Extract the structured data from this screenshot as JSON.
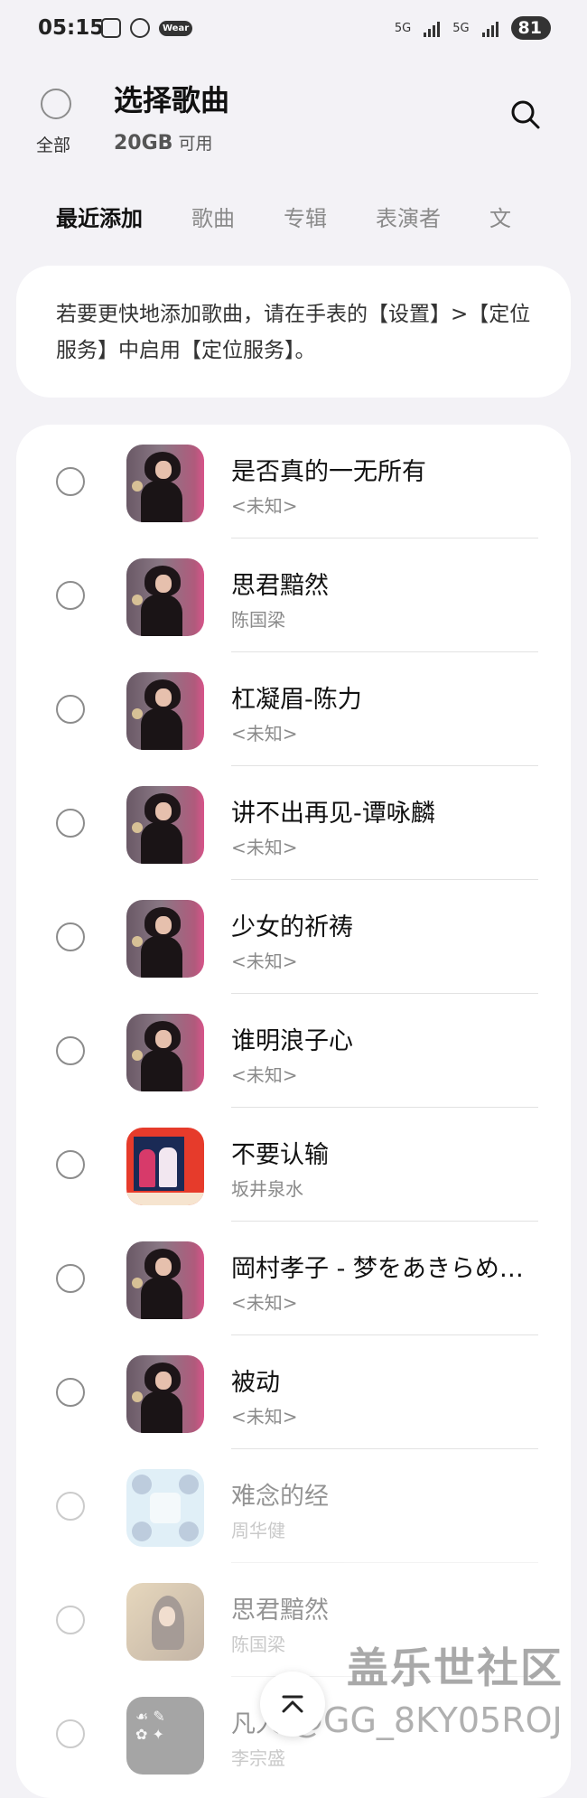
{
  "status_bar": {
    "time": "05:15",
    "icons": [
      "screenshot-icon",
      "location-icon",
      "wear-icon"
    ],
    "wear_label": "Wear",
    "net1": "5G",
    "net2": "5G",
    "battery": "81"
  },
  "header": {
    "select_all_label": "全部",
    "title": "选择歌曲",
    "storage_amount": "20GB",
    "storage_unit": "可用"
  },
  "tabs": [
    {
      "label": "最近添加",
      "active": true
    },
    {
      "label": "歌曲"
    },
    {
      "label": "专辑"
    },
    {
      "label": "表演者"
    },
    {
      "label": "文"
    }
  ],
  "banner": {
    "text": "若要更快地添加歌曲，请在手表的【设置】>【定位服务】中启用【定位服务】。"
  },
  "songs": [
    {
      "title": "是否真的一无所有",
      "artist": "<未知>",
      "art": "woman"
    },
    {
      "title": "思君黯然",
      "artist": "陈国梁",
      "art": "woman"
    },
    {
      "title": "杠凝眉-陈力",
      "artist": "<未知>",
      "art": "woman"
    },
    {
      "title": "讲不出再见-谭咏麟",
      "artist": "<未知>",
      "art": "woman"
    },
    {
      "title": "少女的祈祷",
      "artist": "<未知>",
      "art": "woman"
    },
    {
      "title": "谁明浪子心",
      "artist": "<未知>",
      "art": "woman"
    },
    {
      "title": "不要认输",
      "artist": "坂井泉水",
      "art": "red"
    },
    {
      "title": "岡村孝子 - 梦をあきらめないで",
      "artist": "<未知>",
      "art": "woman"
    },
    {
      "title": "被动",
      "artist": "<未知>",
      "art": "woman"
    },
    {
      "title": "难念的经",
      "artist": "周华健",
      "art": "blue"
    },
    {
      "title": "思君黯然",
      "artist": "陈国梁",
      "art": "warm"
    },
    {
      "title": "凡人",
      "artist": "李宗盛",
      "art": "ink"
    }
  ],
  "watermark": {
    "line1": "盖乐世社区",
    "line2": "@GG_8KY05ROJ"
  },
  "colors": {
    "background": "#f3f2f6",
    "card": "#ffffff",
    "text_primary": "#111111",
    "text_secondary": "#8a8a8a"
  }
}
